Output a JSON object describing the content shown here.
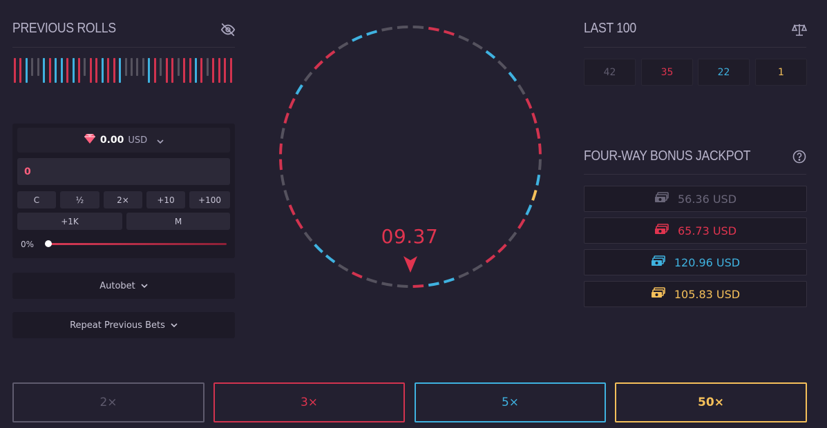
{
  "previous_rolls": {
    "title": "PREVIOUS ROLLS",
    "hide_icon": "eye-slash-icon",
    "rolls": [
      "red",
      "red",
      "blue",
      "gray",
      "gray",
      "blue",
      "red",
      "blue",
      "blue",
      "red",
      "blue",
      "red",
      "gray",
      "red",
      "red",
      "blue",
      "red",
      "red",
      "blue",
      "gray",
      "gray",
      "gray",
      "gray",
      "blue",
      "red",
      "gray",
      "red",
      "red",
      "gray",
      "red",
      "red",
      "blue",
      "red",
      "gray",
      "red",
      "red",
      "red",
      "red"
    ]
  },
  "bet": {
    "currency_icon": "gem-icon",
    "balance": "0.00",
    "currency": "USD",
    "amount": "0",
    "quick": [
      "C",
      "½",
      "2×",
      "+10",
      "+100"
    ],
    "quick2": [
      "+1K",
      "M"
    ],
    "slider_percent": "0%",
    "slider_value": 0
  },
  "autobet_label": "Autobet",
  "repeat_label": "Repeat Previous Bets",
  "wheel": {
    "timer": "09.37",
    "segments": [
      "gray",
      "red",
      "red",
      "gray",
      "gray",
      "blue",
      "gray",
      "blue",
      "gray",
      "red",
      "red",
      "red",
      "red",
      "gray",
      "blue",
      "gold",
      "blue",
      "red",
      "gray",
      "red",
      "red",
      "gray",
      "gray",
      "blue",
      "blue",
      "red",
      "gray",
      "gray",
      "gray",
      "red",
      "gray",
      "blue",
      "blue",
      "gray",
      "red",
      "red",
      "gray",
      "gray",
      "red",
      "red",
      "gray",
      "red",
      "red",
      "blue",
      "gray",
      "red",
      "red",
      "gray",
      "blue",
      "blue",
      "gray",
      "gray"
    ]
  },
  "last100": {
    "title": "LAST 100",
    "icon": "balance-scale-icon",
    "counts": [
      {
        "value": "42",
        "color": "#5f5b6e"
      },
      {
        "value": "35",
        "color": "#e0344f"
      },
      {
        "value": "22",
        "color": "#3fb2e0"
      },
      {
        "value": "1",
        "color": "#f5c05a"
      }
    ]
  },
  "jackpot": {
    "title": "FOUR-WAY BONUS JACKPOT",
    "help_icon": "question-circle-icon",
    "items": [
      {
        "amount": "56.36 USD",
        "color": "#6a6679",
        "icon": "cash-stack-icon"
      },
      {
        "amount": "65.73 USD",
        "color": "#e0344f",
        "icon": "cash-stack-icon"
      },
      {
        "amount": "120.96 USD",
        "color": "#3fb2e0",
        "icon": "cash-stack-icon"
      },
      {
        "amount": "105.83 USD",
        "color": "#f5c05a",
        "icon": "cash-stack-icon"
      }
    ]
  },
  "multipliers": [
    {
      "label": "2×",
      "color": "#5f5b6e",
      "text": "#5f5b6e"
    },
    {
      "label": "3×",
      "color": "#d2334f",
      "text": "#e0344f"
    },
    {
      "label": "5×",
      "color": "#3fb2e0",
      "text": "#3fb2e0"
    },
    {
      "label": "50×",
      "color": "#f5c05a",
      "text": "#f5c05a"
    }
  ],
  "colors": {
    "red": "#d2334f",
    "blue": "#3fb2e0",
    "gray": "#55525e",
    "gold": "#f5c05a"
  }
}
